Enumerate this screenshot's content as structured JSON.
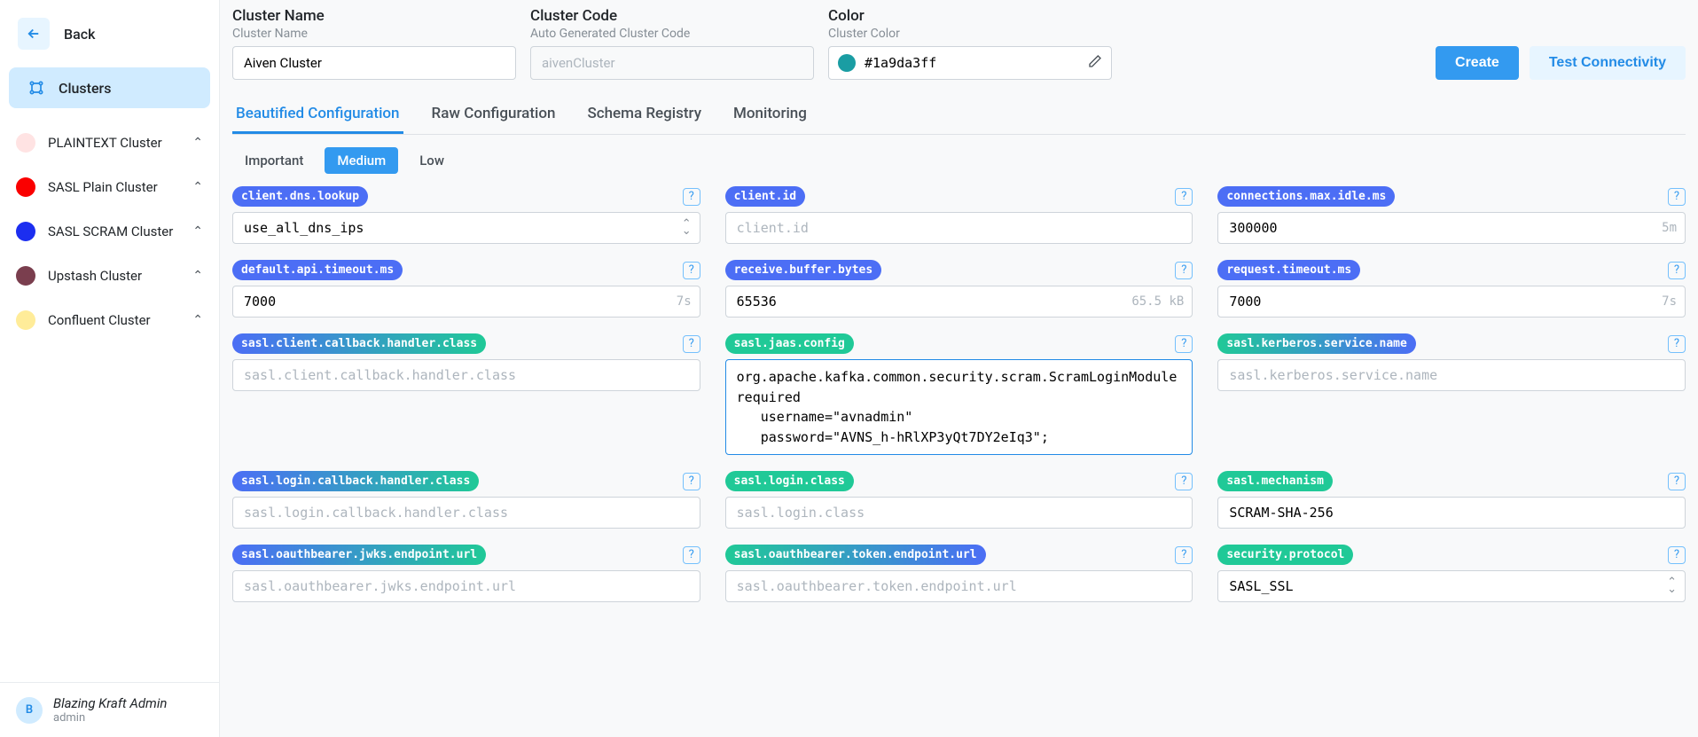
{
  "back": "Back",
  "nav": {
    "clusters": "Clusters"
  },
  "clusters": [
    {
      "name": "PLAINTEXT Cluster",
      "color": "#ffe3e3"
    },
    {
      "name": "SASL Plain Cluster",
      "color": "#fa0000"
    },
    {
      "name": "SASL SCRAM Cluster",
      "color": "#1c2ef0"
    },
    {
      "name": "Upstash Cluster",
      "color": "#7a3e4e"
    },
    {
      "name": "Confluent Cluster",
      "color": "#ffec99"
    }
  ],
  "user": {
    "initial": "B",
    "name": "Blazing Kraft Admin",
    "role": "admin"
  },
  "form": {
    "clusterName": {
      "label": "Cluster Name",
      "sub": "Cluster Name",
      "value": "Aiven Cluster"
    },
    "clusterCode": {
      "label": "Cluster Code",
      "sub": "Auto Generated Cluster Code",
      "placeholder": "aivenCluster"
    },
    "color": {
      "label": "Color",
      "sub": "Cluster Color",
      "value": "#1a9da3ff",
      "swatch": "#1a9da3"
    },
    "create": "Create",
    "test": "Test Connectivity"
  },
  "tabs": [
    "Beautified Configuration",
    "Raw Configuration",
    "Schema Registry",
    "Monitoring"
  ],
  "levels": [
    "Important",
    "Medium",
    "Low"
  ],
  "config": {
    "client_dns_lookup": {
      "key": "client.dns.lookup",
      "value": "use_all_dns_ips"
    },
    "client_id": {
      "key": "client.id",
      "placeholder": "client.id"
    },
    "connections_max_idle": {
      "key": "connections.max.idle.ms",
      "value": "300000",
      "hint": "5m"
    },
    "default_api_timeout": {
      "key": "default.api.timeout.ms",
      "value": "7000",
      "hint": "7s"
    },
    "receive_buffer": {
      "key": "receive.buffer.bytes",
      "value": "65536",
      "hint": "65.5 kB"
    },
    "request_timeout": {
      "key": "request.timeout.ms",
      "value": "7000",
      "hint": "7s"
    },
    "sasl_client_cb": {
      "key": "sasl.client.callback.handler.class",
      "placeholder": "sasl.client.callback.handler.class"
    },
    "sasl_jaas": {
      "key": "sasl.jaas.config",
      "value": "org.apache.kafka.common.security.scram.ScramLoginModule required\n   username=\"avnadmin\"\n   password=\"AVNS_h-hRlXP3yQt7DY2eIq3\";"
    },
    "sasl_krb_svc": {
      "key": "sasl.kerberos.service.name",
      "placeholder": "sasl.kerberos.service.name"
    },
    "sasl_login_cb": {
      "key": "sasl.login.callback.handler.class",
      "placeholder": "sasl.login.callback.handler.class"
    },
    "sasl_login_class": {
      "key": "sasl.login.class",
      "placeholder": "sasl.login.class"
    },
    "sasl_mechanism": {
      "key": "sasl.mechanism",
      "value": "SCRAM-SHA-256"
    },
    "sasl_jwks": {
      "key": "sasl.oauthbearer.jwks.endpoint.url",
      "placeholder": "sasl.oauthbearer.jwks.endpoint.url"
    },
    "sasl_token": {
      "key": "sasl.oauthbearer.token.endpoint.url",
      "placeholder": "sasl.oauthbearer.token.endpoint.url"
    },
    "security_protocol": {
      "key": "security.protocol",
      "value": "SASL_SSL"
    }
  }
}
